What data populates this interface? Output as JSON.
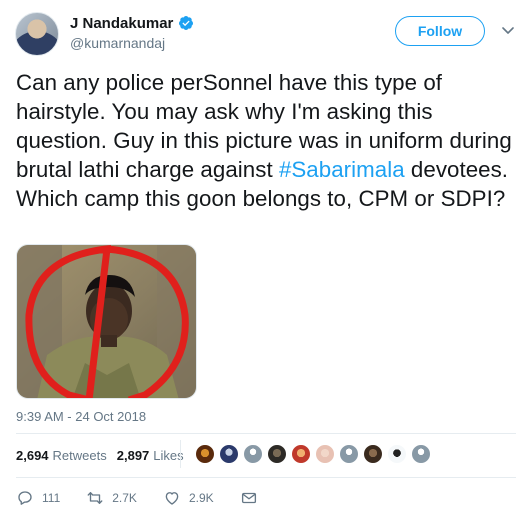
{
  "author": {
    "display_name": "J Nandakumar",
    "handle": "@kumarnandaj",
    "verified": true
  },
  "follow_button_label": "Follow",
  "tweet": {
    "text_before": "Can any police perSonnel have this type of hairstyle. You may ask why I'm asking this question. Guy in this picture was in uniform during brutal lathi charge against ",
    "hashtag": "#Sabarimala",
    "text_after": " devotees. Which camp this goon belongs to, CPM or SDPI?"
  },
  "timestamp": "9:39 AM - 24 Oct 2018",
  "stats": {
    "retweets_count": "2,694",
    "retweets_label": "Retweets",
    "likes_count": "2,897",
    "likes_label": "Likes"
  },
  "likers": [
    "liker-1",
    "liker-2",
    "liker-3",
    "liker-4",
    "liker-5",
    "liker-6",
    "liker-7",
    "liker-8",
    "liker-9",
    "liker-10"
  ],
  "actions": {
    "replies": "111",
    "retweets": "2.7K",
    "likes": "2.9K"
  },
  "colors": {
    "accent": "#1da1f2",
    "text": "#14171a",
    "muted": "#657786",
    "highlight_ring": "#e0201c"
  }
}
